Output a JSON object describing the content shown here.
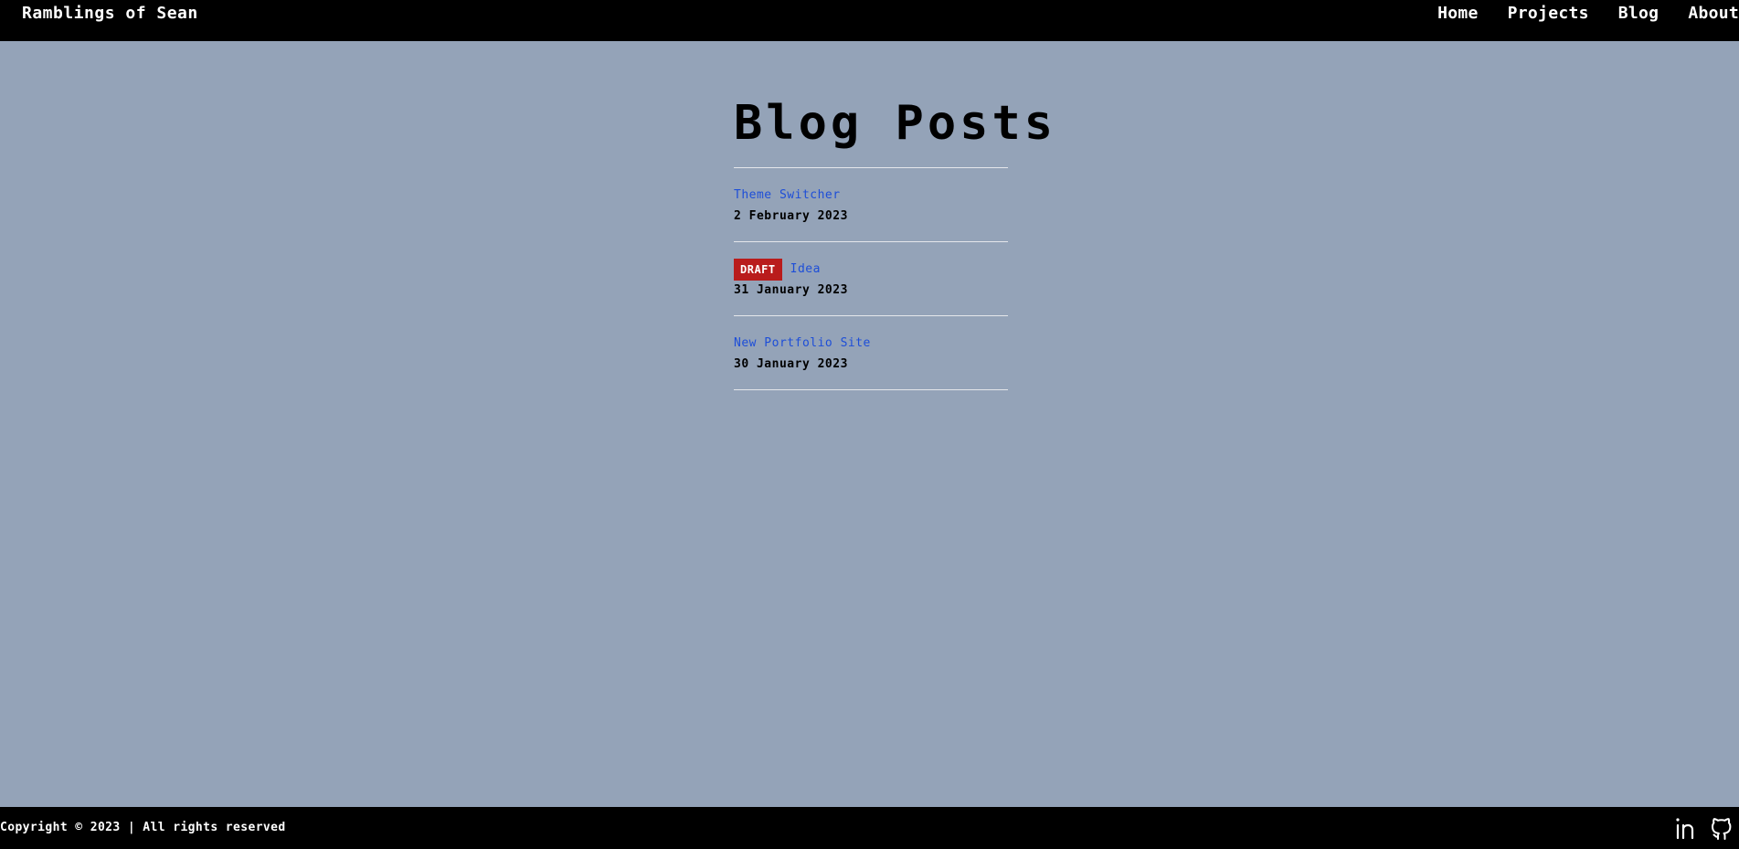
{
  "header": {
    "site_title": "Ramblings of Sean",
    "nav": [
      {
        "label": "Home"
      },
      {
        "label": "Projects"
      },
      {
        "label": "Blog"
      },
      {
        "label": "About"
      }
    ]
  },
  "main": {
    "title": "Blog Posts",
    "posts": [
      {
        "title": "Theme Switcher",
        "date": "2 February 2023",
        "draft": false
      },
      {
        "title": "Idea",
        "date": "31 January 2023",
        "draft": true,
        "badge": "DRAFT"
      },
      {
        "title": "New Portfolio Site",
        "date": "30 January 2023",
        "draft": false
      }
    ]
  },
  "footer": {
    "copyright": "Copyright © 2023 | All rights reserved",
    "social": [
      {
        "icon": "linkedin-icon"
      },
      {
        "icon": "github-icon"
      }
    ]
  },
  "colors": {
    "background": "#94a3b8",
    "bar": "#000000",
    "link": "#1d4ed8",
    "draft_badge": "#b91c1c",
    "divider": "#e5e7eb"
  }
}
